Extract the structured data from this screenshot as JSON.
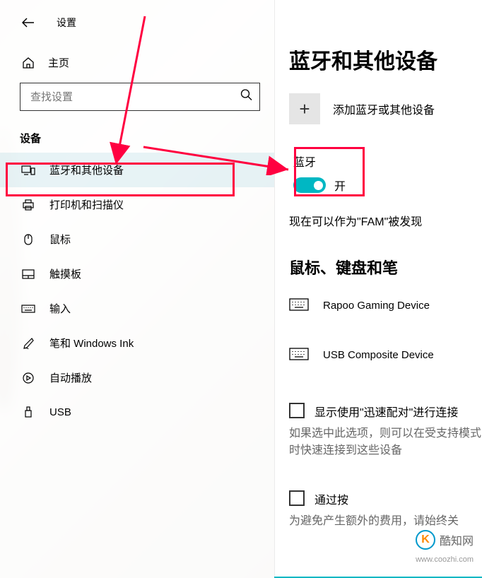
{
  "header": {
    "title": "设置"
  },
  "sidebar": {
    "home_label": "主页",
    "search_placeholder": "查找设置",
    "category": "设备",
    "items": [
      {
        "label": "蓝牙和其他设备",
        "icon": "devices"
      },
      {
        "label": "打印机和扫描仪",
        "icon": "printer"
      },
      {
        "label": "鼠标",
        "icon": "mouse"
      },
      {
        "label": "触摸板",
        "icon": "touchpad"
      },
      {
        "label": "输入",
        "icon": "keyboard"
      },
      {
        "label": "笔和 Windows Ink",
        "icon": "pen"
      },
      {
        "label": "自动播放",
        "icon": "autoplay"
      },
      {
        "label": "USB",
        "icon": "usb"
      }
    ]
  },
  "main": {
    "page_title": "蓝牙和其他设备",
    "add_device_label": "添加蓝牙或其他设备",
    "bluetooth": {
      "label": "蓝牙",
      "state_label": "开",
      "status": "现在可以作为\"FAM\"被发现"
    },
    "devices_section_title": "鼠标、键盘和笔",
    "devices": [
      {
        "name": "Rapoo Gaming Device"
      },
      {
        "name": "USB Composite Device"
      }
    ],
    "checkbox1_label": "显示使用\"迅速配对\"进行连接",
    "checkbox1_desc": "如果选中此选项，则可以在受支持模式时快速连接到这些设备",
    "checkbox2_label": "通过按",
    "checkbox2_desc": "为避免产生额外的费用，请始终关"
  },
  "watermark": {
    "text": "酷知网",
    "url": "www.coozhi.com"
  }
}
